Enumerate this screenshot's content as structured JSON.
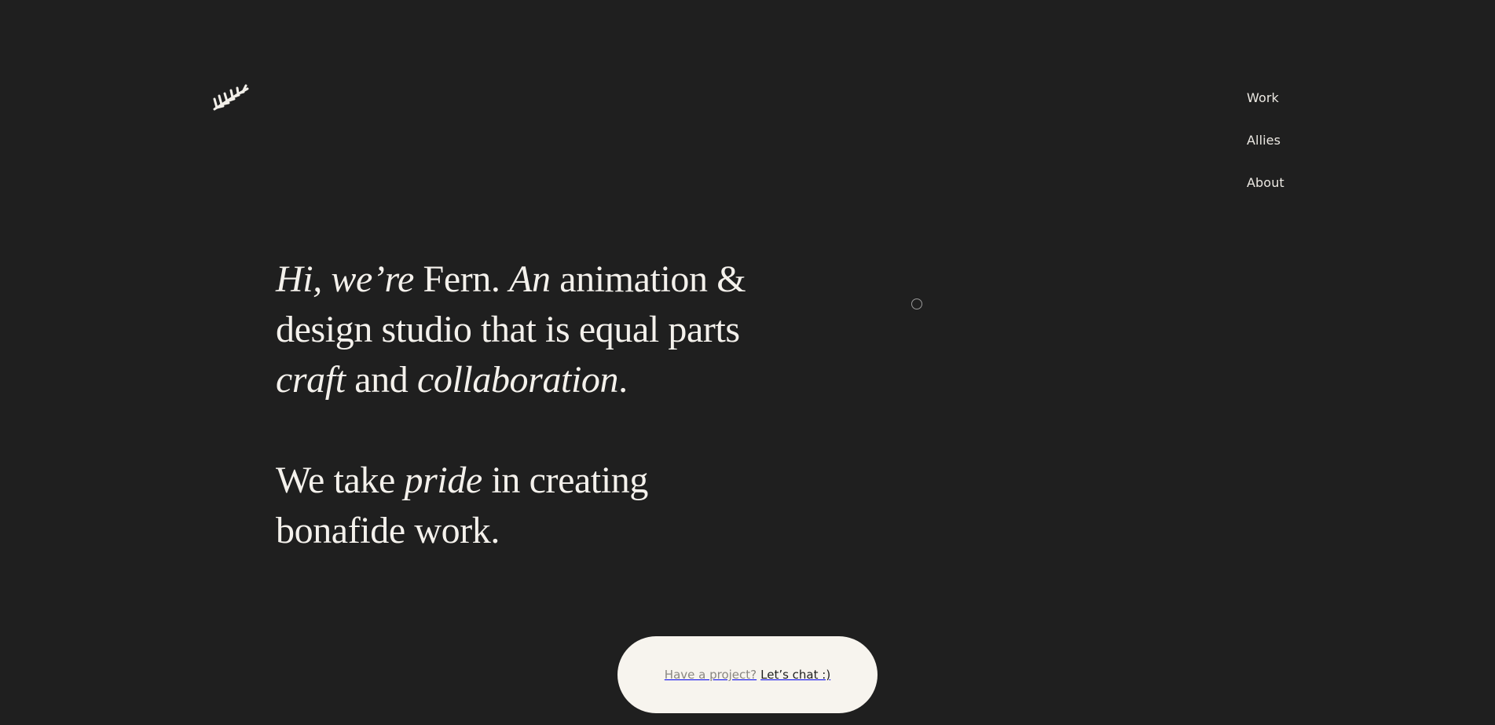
{
  "logo": {
    "icon": "fern-leaf-icon"
  },
  "nav": {
    "items": [
      {
        "label": "Work"
      },
      {
        "label": "Allies"
      },
      {
        "label": "About"
      }
    ]
  },
  "hero": {
    "intro": {
      "hi": "Hi, we’re",
      "fern": " Fern. ",
      "an": "An",
      "mid": " animation & design studio that is equal parts ",
      "craft": "craft",
      "and": " and ",
      "collaboration": "collaboration",
      "end": "."
    },
    "pride": {
      "start": "We take ",
      "pride": "pride",
      "end": " in creating bonafide work."
    }
  },
  "cta": {
    "prompt": "Have a project?",
    "action": "Let’s chat :)"
  },
  "colors": {
    "background": "#1f1f1f",
    "text": "#f4f1ec",
    "cta_background": "#f7f4ee"
  }
}
